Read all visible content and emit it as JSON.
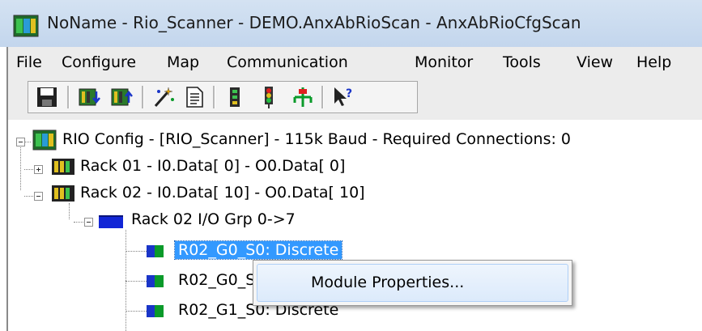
{
  "window": {
    "title": "NoName - Rio_Scanner - DEMO.AnxAbRioScan - AnxAbRioCfgScan",
    "app_icon": "rack-app-icon"
  },
  "menu": [
    {
      "label": "File"
    },
    {
      "label": "Configure"
    },
    {
      "label": "Map"
    },
    {
      "label": "Communication"
    },
    {
      "label": "Monitor"
    },
    {
      "label": "Tools"
    },
    {
      "label": "View"
    },
    {
      "label": "Help"
    }
  ],
  "toolbar": [
    {
      "icon": "save-icon"
    },
    {
      "icon": "rack-download-icon"
    },
    {
      "icon": "rack-upload-icon"
    },
    {
      "icon": "wizard-icon"
    },
    {
      "icon": "document-icon"
    },
    {
      "icon": "io-module-icon"
    },
    {
      "icon": "traffic-light-icon"
    },
    {
      "icon": "network-icon"
    },
    {
      "icon": "help-pointer-icon"
    }
  ],
  "tree": {
    "root": "RIO Config - [RIO_Scanner] - 115k Baud - Required Connections: 0",
    "rack01": "Rack 01 - I0.Data[ 0] - O0.Data[ 0]",
    "rack02": "Rack 02 - I0.Data[ 10] - O0.Data[ 10]",
    "group": "Rack 02 I/O Grp 0->7",
    "modules": [
      {
        "label": "R02_G0_S0: Discrete"
      },
      {
        "label": "R02_G0_S"
      },
      {
        "label": "R02_G1_S0: Discrete"
      }
    ]
  },
  "context_menu": {
    "item": "Module Properties..."
  },
  "colors": {
    "selection": "#3399ff",
    "group_icon": "#1226d6",
    "module_green": "#0a9a2a",
    "module_blue": "#1a35c8"
  }
}
